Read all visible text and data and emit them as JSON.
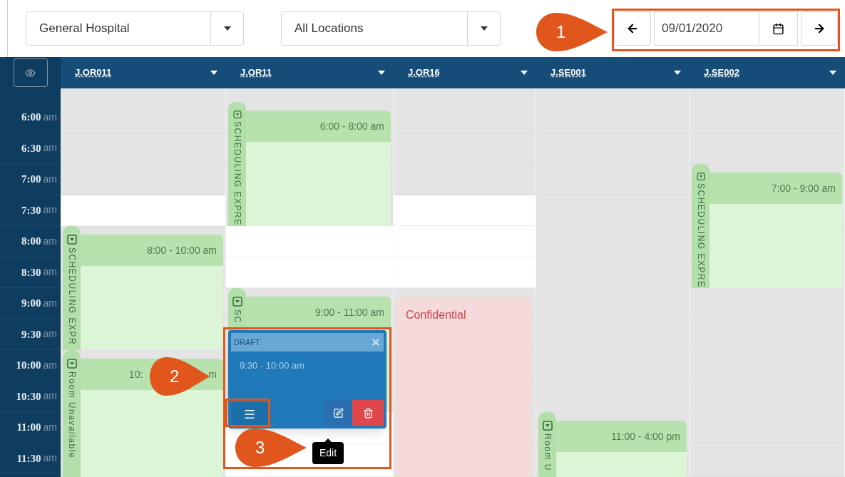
{
  "toolbar": {
    "facility": {
      "value": "General Hospital"
    },
    "location": {
      "value": "All Locations"
    },
    "date": {
      "value": "09/01/2020"
    }
  },
  "times": [
    {
      "time": "6:00",
      "period": "am"
    },
    {
      "time": "6:30",
      "period": "am"
    },
    {
      "time": "7:00",
      "period": "am"
    },
    {
      "time": "7:30",
      "period": "am"
    },
    {
      "time": "8:00",
      "period": "am"
    },
    {
      "time": "8:30",
      "period": "am"
    },
    {
      "time": "9:00",
      "period": "am"
    },
    {
      "time": "9:30",
      "period": "am"
    },
    {
      "time": "10:00",
      "period": "am"
    },
    {
      "time": "10:30",
      "period": "am"
    },
    {
      "time": "11:00",
      "period": "am"
    },
    {
      "time": "11:30",
      "period": "am"
    }
  ],
  "columns": [
    {
      "name": "J.OR011",
      "slots": [
        {
          "open": false
        },
        {
          "open": false
        },
        {
          "open": false
        },
        {
          "open": true
        },
        {
          "event": {
            "kind": "block",
            "side_label": "SCHEDULING EXPR",
            "time_label": "8:00 - 10:00 am"
          }
        },
        {
          "continued": true
        },
        {
          "continued": true
        },
        {
          "continued": true
        },
        {
          "event": {
            "kind": "block",
            "side_label": "Room Unavailable",
            "time_label": "10:",
            "time_label_end": "m"
          }
        },
        {
          "continued": true
        },
        {
          "continued": true
        },
        {
          "continued": true
        }
      ]
    },
    {
      "name": "J.OR11",
      "slots": [
        {
          "event": {
            "kind": "block",
            "side_label": "SCHEDULING EXPRE",
            "time_label": "6:00 - 8:00 am"
          }
        },
        {
          "continued": true
        },
        {
          "continued": true
        },
        {
          "continued": true
        },
        {
          "open": true
        },
        {
          "open": true
        },
        {
          "event": {
            "kind": "block",
            "side_label": "SC",
            "time_label": "9:00 - 11:00 am"
          }
        },
        {
          "continued": true
        },
        {
          "continued": true
        },
        {
          "continued": true
        },
        {
          "open": true
        },
        {
          "open": true
        }
      ]
    },
    {
      "name": "J.OR16",
      "slots": [
        {
          "open": false
        },
        {
          "open": false
        },
        {
          "open": false
        },
        {
          "open": true
        },
        {
          "open": true
        },
        {
          "open": true
        },
        {
          "event": {
            "kind": "confidential",
            "title": "Confidential"
          }
        },
        {
          "continued": true
        },
        {
          "continued": true
        },
        {
          "continued": true
        },
        {
          "continued": true
        },
        {
          "continued": true
        }
      ]
    },
    {
      "name": "J.SE001",
      "slots": [
        {
          "open": false
        },
        {
          "open": false
        },
        {
          "open": false
        },
        {
          "open": false
        },
        {
          "open": false
        },
        {
          "open": false
        },
        {
          "open": false
        },
        {
          "open": false
        },
        {
          "open": false
        },
        {
          "open": false
        },
        {
          "event": {
            "kind": "block",
            "side_label": "Room U",
            "time_label": "11:00 - 4:00 pm"
          }
        },
        {
          "continued": true
        }
      ]
    },
    {
      "name": "J.SE002",
      "slots": [
        {
          "open": false
        },
        {
          "open": false
        },
        {
          "event": {
            "kind": "block",
            "side_label": "SCHEDULING EXPRE",
            "time_label": "7:00 - 9:00 am"
          }
        },
        {
          "continued": true
        },
        {
          "continued": true
        },
        {
          "continued": true
        },
        {
          "open": false
        },
        {
          "open": false
        },
        {
          "open": false
        },
        {
          "open": false
        },
        {
          "open": false
        },
        {
          "open": false
        }
      ]
    }
  ],
  "popup": {
    "status": "DRAFT",
    "time": "9:30 - 10:00 am",
    "tooltip": "Edit"
  },
  "callouts": [
    {
      "number": "1"
    },
    {
      "number": "2"
    },
    {
      "number": "3"
    }
  ]
}
